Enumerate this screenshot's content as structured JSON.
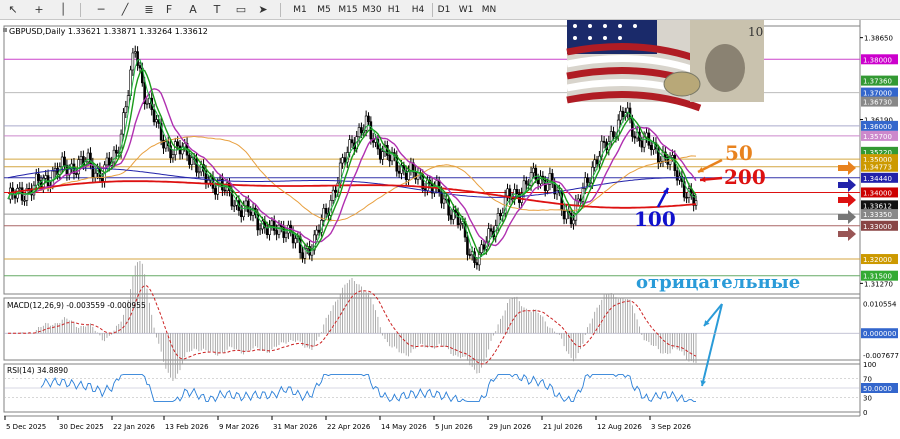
{
  "toolbar": {
    "tools": [
      {
        "name": "cursor-icon",
        "glyph": "↖"
      },
      {
        "name": "crosshair-icon",
        "glyph": "+"
      },
      {
        "name": "vertical-line-icon",
        "glyph": "│"
      },
      {
        "name": "horizontal-line-icon",
        "glyph": "─"
      },
      {
        "name": "trendline-icon",
        "glyph": "╱"
      },
      {
        "name": "channel-icon",
        "glyph": "≣"
      },
      {
        "name": "fibonacci-icon",
        "glyph": "F"
      },
      {
        "name": "text-icon",
        "glyph": "A"
      },
      {
        "name": "label-icon",
        "glyph": "T"
      },
      {
        "name": "shapes-icon",
        "glyph": "▭"
      },
      {
        "name": "arrows-icon",
        "glyph": "➤"
      }
    ],
    "timeframes": [
      "M1",
      "M5",
      "M15",
      "M30",
      "H1",
      "H4",
      "D1",
      "W1",
      "MN"
    ]
  },
  "chart": {
    "symbol_header": "GBPUSD,Daily  1.33621 1.33871 1.33264 1.33612",
    "macd_header": "MACD(12,26,9) -0.003559 -0.000955",
    "rsi_header": "RSI(14) 34.8890",
    "price_labels": [
      {
        "text": "1.38650",
        "price": 1.3865
      },
      {
        "text": "1.38000",
        "price": 1.38,
        "box": "#cc00cc"
      },
      {
        "text": "1.37360",
        "price": 1.3736,
        "box": "#339933"
      },
      {
        "text": "1.37000",
        "price": 1.37,
        "box": "#3366cc"
      },
      {
        "text": "1.36730",
        "price": 1.3673,
        "box": "#888888"
      },
      {
        "text": "1.36190",
        "price": 1.3619
      },
      {
        "text": "1.36000",
        "price": 1.36,
        "box": "#3366cc"
      },
      {
        "text": "1.35700",
        "price": 1.357,
        "box": "#cc88cc"
      },
      {
        "text": "1.35220",
        "price": 1.3522,
        "box": "#339933"
      },
      {
        "text": "1.35000",
        "price": 1.35,
        "box": "#cc9900"
      },
      {
        "text": "1.34773",
        "price": 1.34773,
        "box": "#cc9900"
      },
      {
        "text": "1.34440",
        "price": 1.3444,
        "box": "#2222aa"
      },
      {
        "text": "1.34000",
        "price": 1.34,
        "box": "#cc0000"
      },
      {
        "text": "1.33612",
        "price": 1.33612,
        "box": "#111111"
      },
      {
        "text": "1.33350",
        "price": 1.3335,
        "box": "#888888"
      },
      {
        "text": "1.33000",
        "price": 1.33,
        "box": "#884444"
      },
      {
        "text": "1.32000",
        "price": 1.32,
        "box": "#cc9900"
      },
      {
        "text": "1.31500",
        "price": 1.315,
        "box": "#33aa33"
      },
      {
        "text": "1.31270",
        "price": 1.3127
      }
    ],
    "macd_labels": [
      {
        "text": "0.010554",
        "value": 0.010554
      },
      {
        "text": "0.000000",
        "value": 0,
        "box": "#3366cc"
      },
      {
        "text": "-0.007677",
        "value": -0.007677
      }
    ],
    "rsi_labels": [
      {
        "text": "100",
        "value": 100
      },
      {
        "text": "70",
        "value": 70
      },
      {
        "text": "50.0000",
        "value": 50,
        "box": "#3366cc"
      },
      {
        "text": "30",
        "value": 30
      },
      {
        "text": "0",
        "value": 0
      }
    ],
    "dates": [
      "5 Dec 2025",
      "30 Dec 2025",
      "22 Jan 2026",
      "13 Feb 2026",
      "9 Mar 2026",
      "31 Mar 2026",
      "22 Apr 2026",
      "14 May 2026",
      "5 Jun 2026",
      "29 Jun 2026",
      "21 Jul 2026",
      "12 Aug 2026",
      "3 Sep 2026"
    ],
    "annotations": [
      {
        "text": "50",
        "color": "#e8821e"
      },
      {
        "text": "200",
        "color": "#dd1111"
      },
      {
        "text": "100",
        "color": "#1111cc"
      },
      {
        "text": "отрицательные",
        "color": "#2a9bd8"
      }
    ],
    "colors": {
      "ma_fast": "#1a9a1a",
      "ma_mid": "#2222aa",
      "ma_slow": "#b030b0",
      "ma_50": "#e8a040",
      "ma_200": "#dd1111",
      "candle": "#000000",
      "macd_hist": "#999999",
      "macd_signal": "#cc2222",
      "rsi_line": "#2a7fd8"
    }
  }
}
